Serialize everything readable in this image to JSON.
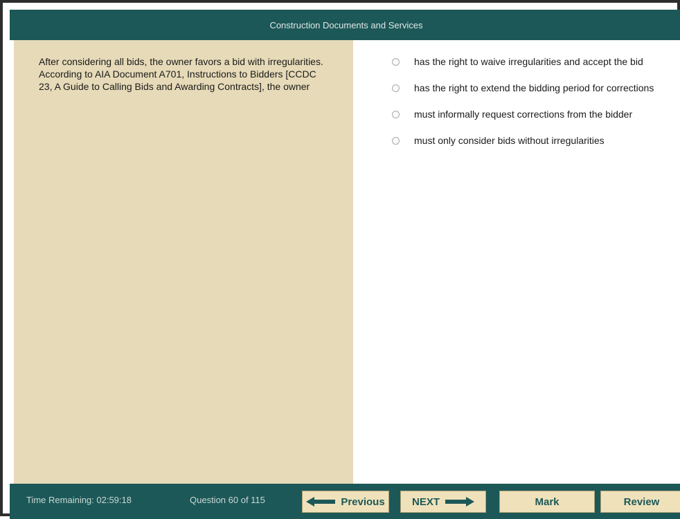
{
  "header": {
    "title": "Construction Documents and Services"
  },
  "question": {
    "stem": "After considering all bids, the owner favors a bid with irregularities. According to AIA Document A701, Instructions to Bidders [CCDC 23, A Guide to Calling Bids and Awarding Contracts], the owner"
  },
  "answers": [
    {
      "label": "has the right to waive irregularities and accept the bid"
    },
    {
      "label": "has the right to extend the bidding period for corrections"
    },
    {
      "label": "must informally request corrections from the bidder"
    },
    {
      "label": "must only consider bids without irregularities"
    }
  ],
  "footer": {
    "time_remaining": "Time Remaining: 02:59:18",
    "question_counter": "Question 60 of 115",
    "previous_label": "Previous",
    "next_label": "NEXT",
    "mark_label": "Mark",
    "review_label": "Review"
  },
  "icons": {
    "previous": "arrow-left-icon",
    "next": "arrow-right-icon",
    "radio": "radio-icon"
  },
  "colors": {
    "bar": "#1d5858",
    "left_panel": "#e6dab8",
    "button": "#efe2bb",
    "button_text": "#1d5858"
  }
}
